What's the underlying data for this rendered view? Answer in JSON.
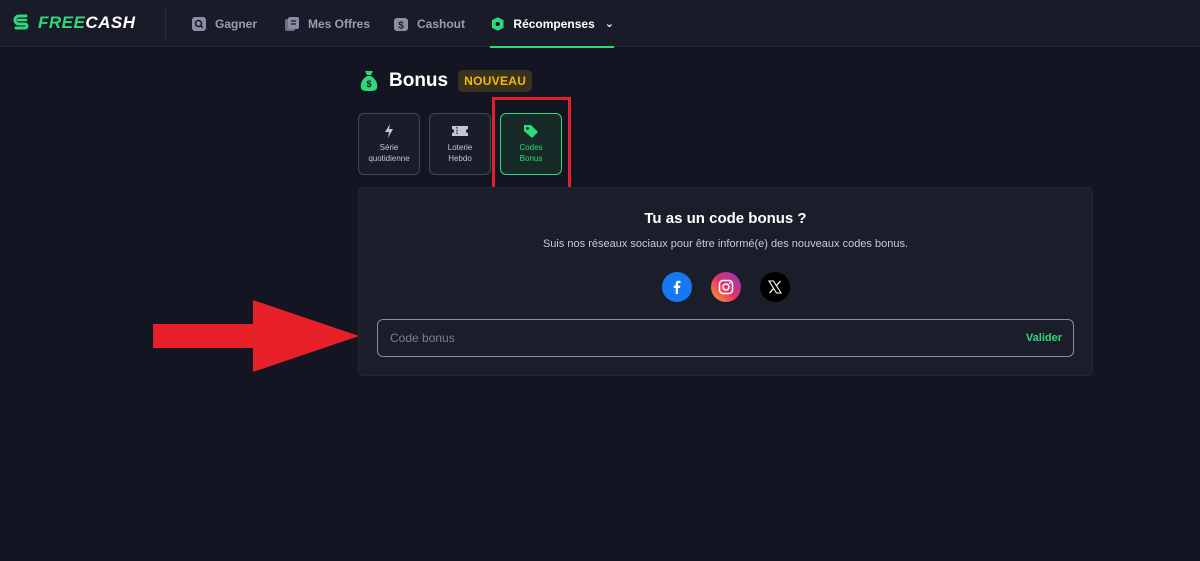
{
  "brand": {
    "free": "FREE",
    "cash": "CASH",
    "accent": "#2fd87a"
  },
  "nav": {
    "items": [
      {
        "label": "Gagner",
        "icon": "search-square-icon"
      },
      {
        "label": "Mes Offres",
        "icon": "offers-icon"
      },
      {
        "label": "Cashout",
        "icon": "dollar-card-icon"
      },
      {
        "label": "Récompenses",
        "icon": "gift-box-icon",
        "active": true,
        "dropdown": "chevron-down-icon"
      }
    ]
  },
  "bonus": {
    "title": "Bonus",
    "badge": "NOUVEAU",
    "badge_color": "#f5b800",
    "tabs": [
      {
        "label": "Série\nquotidienne",
        "icon": "bolt-icon"
      },
      {
        "label": "Loterie\nHebdo",
        "icon": "ticket-icon"
      },
      {
        "label": "Codes\nBonus",
        "icon": "tag-icon",
        "active": true
      }
    ]
  },
  "card": {
    "title": "Tu as un code bonus ?",
    "subtitle": "Suis nos réseaux sociaux pour être informé(e) des nouveaux codes bonus.",
    "socials": [
      "facebook-icon",
      "instagram-icon",
      "x-icon"
    ],
    "input_placeholder": "Code bonus",
    "submit_label": "Valider"
  },
  "annotations": {
    "highlight_color": "#e0202a",
    "arrow_color": "#e8202a"
  }
}
